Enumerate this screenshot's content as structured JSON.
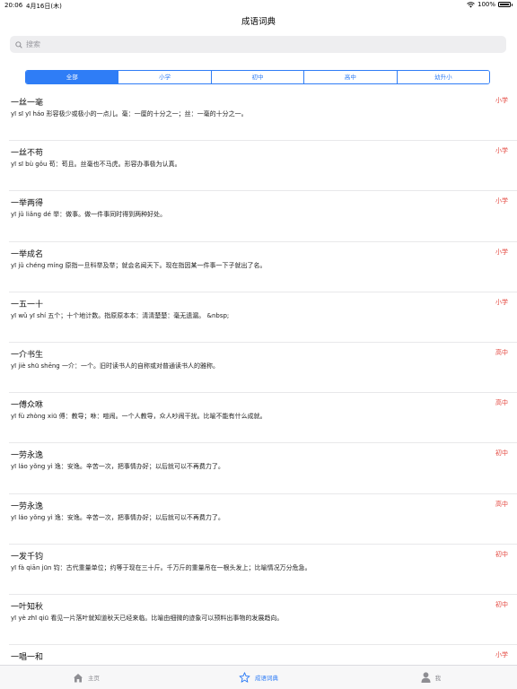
{
  "status": {
    "time": "20:06",
    "date": "4月16日(木)",
    "battery": "100%",
    "battery_level": 1.0
  },
  "nav": {
    "title": "成语词典"
  },
  "search": {
    "placeholder": "搜索"
  },
  "segments": [
    "全部",
    "小学",
    "初中",
    "高中",
    "幼升小"
  ],
  "selected_segment": "全部",
  "idioms": [
    {
      "title": "一丝一毫",
      "level": "小学",
      "desc": "yī sī yī háo 形容极少或极小的一点儿。毫：一厘的十分之一；丝：一毫的十分之一。"
    },
    {
      "title": "一丝不苟",
      "level": "小学",
      "desc": "yī sī bù gǒu 苟：苟且。丝毫也不马虎。形容办事极为认真。"
    },
    {
      "title": "一举两得",
      "level": "小学",
      "desc": "yī jǔ liǎng dé 举：做事。做一件事同时得到两种好处。"
    },
    {
      "title": "一举成名",
      "level": "小学",
      "desc": "yī jǔ chéng míng 原指一旦科举及举；就会名闻天下。现在指因某一件事一下子就出了名。"
    },
    {
      "title": "一五一十",
      "level": "小学",
      "desc": "yī wǔ yī shí 五个；十个地计数。指原原本本：清清楚楚：毫无遗漏。 &nbsp;"
    },
    {
      "title": "一介书生",
      "level": "高中",
      "desc": "yī jiè shū shēng 一介：一个。旧时读书人的自称或对普通读书人的雅称。"
    },
    {
      "title": "一傅众咻",
      "level": "高中",
      "desc": "yī fù zhòng xiū 傅：教导；咻：喧闹。一个人教导，众人吵闹干扰。比喻不能有什么成就。"
    },
    {
      "title": "一劳永逸",
      "level": "初中",
      "desc": "yī láo yǒng yì 逸：安逸。辛苦一次，把事情办好；以后就可以不再费力了。"
    },
    {
      "title": "一劳永逸",
      "level": "高中",
      "desc": "yī láo yǒng yì 逸：安逸。辛苦一次，把事情办好；以后就可以不再费力了。"
    },
    {
      "title": "一发千钧",
      "level": "初中",
      "desc": "yī fà qiān jūn 钧：古代重量单位；约等于现在三十斤。千万斤的重量吊在一根头发上；比喻情况万分危急。"
    },
    {
      "title": "一叶知秋",
      "level": "初中",
      "desc": "yī yè zhī qiū 看见一片落叶就知道秋天已经来临。比喻由细微的迹象可以预料出事物的发展趋向。"
    },
    {
      "title": "一唱一和",
      "level": "小学",
      "desc": ""
    }
  ],
  "tabs": [
    {
      "label": "主页",
      "icon": "home-icon",
      "active": false
    },
    {
      "label": "成语词典",
      "icon": "star-icon",
      "active": true
    },
    {
      "label": "我",
      "icon": "person-icon",
      "active": false
    }
  ],
  "colors": {
    "accent": "#2f7df6",
    "level": "#e4473f",
    "inactive": "#8e8e93"
  }
}
